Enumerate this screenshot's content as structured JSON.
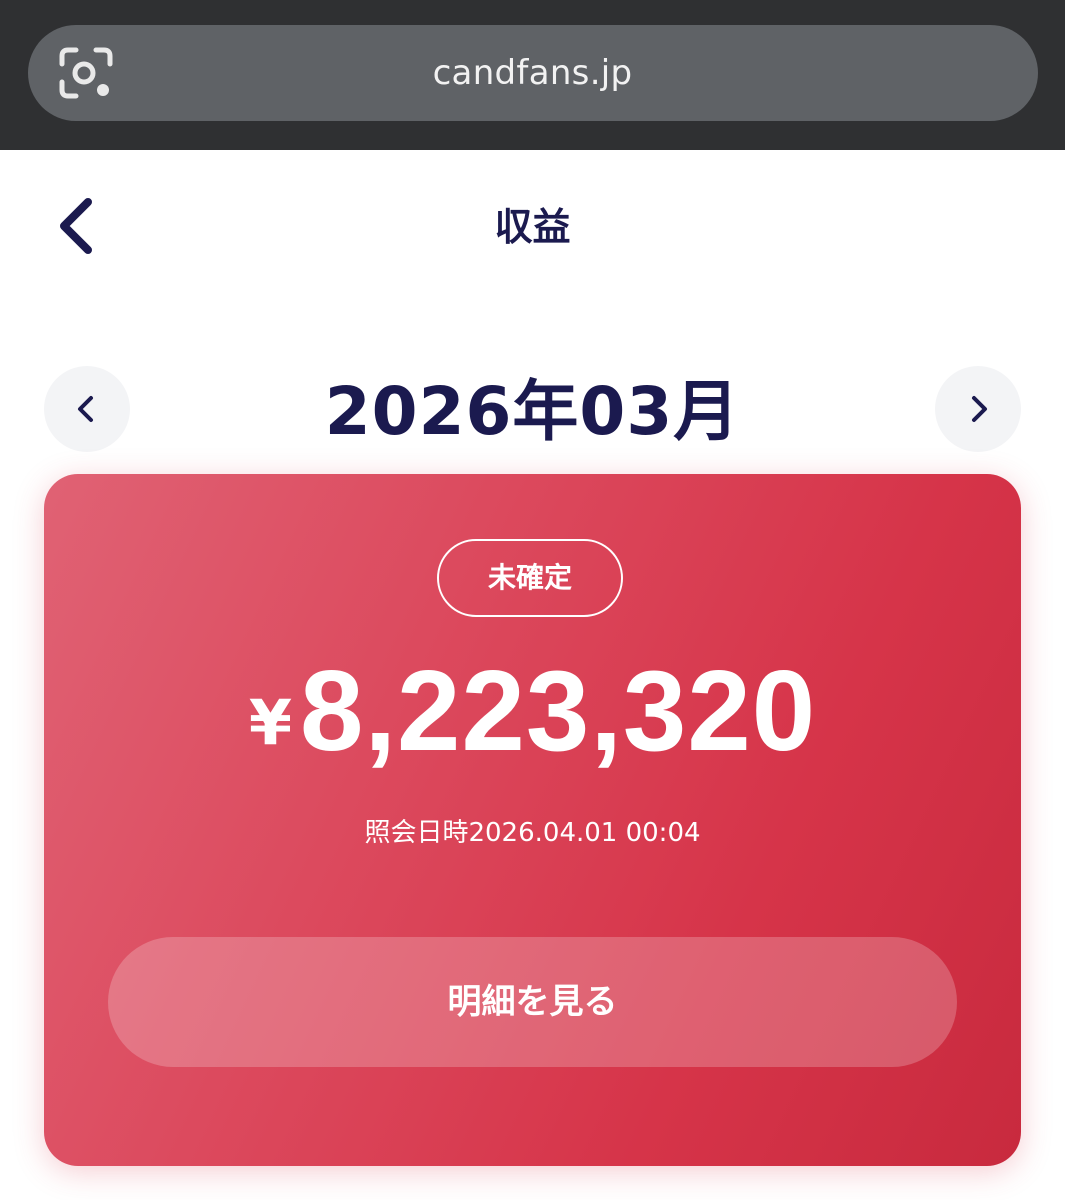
{
  "browser": {
    "url": "candfans.jp",
    "lens_icon": "camera-lens-icon"
  },
  "header": {
    "title": "収益",
    "back_icon": "chevron-left-icon"
  },
  "month_nav": {
    "label": "2026年03月",
    "prev_icon": "chevron-left-icon",
    "next_icon": "chevron-right-icon"
  },
  "earnings": {
    "status": "未確定",
    "currency": "¥",
    "amount": "8,223,320",
    "query_time": "照会日時2026.04.01 00:04",
    "details_button": "明細を見る",
    "card_color": "#d63449"
  },
  "colors": {
    "title": "#1b1a4f",
    "browser_bar": "#2f3032"
  }
}
